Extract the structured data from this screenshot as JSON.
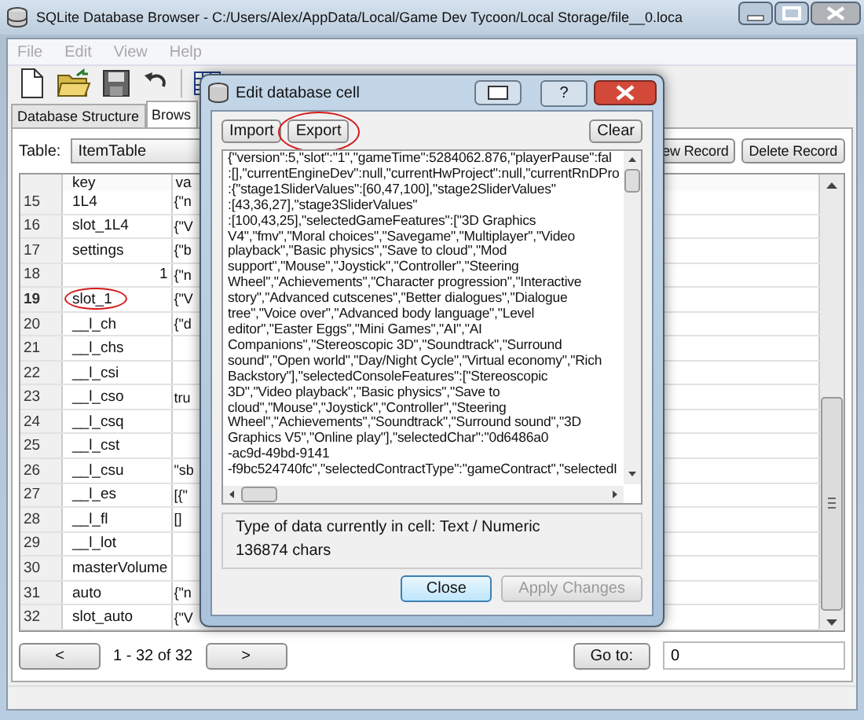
{
  "window": {
    "title": "SQLite Database Browser - C:/Users/Alex/AppData/Local/Game Dev Tycoon/Local Storage/file__0.loca"
  },
  "menu": [
    {
      "label": "File",
      "disabled": true
    },
    {
      "label": "Edit",
      "disabled": true
    },
    {
      "label": "View",
      "disabled": true
    },
    {
      "label": "Help",
      "disabled": true
    }
  ],
  "tabs": [
    {
      "label": "Database Structure",
      "selected": false
    },
    {
      "label": "Brows",
      "selected": true
    }
  ],
  "table_select": {
    "label": "Table:",
    "value": "ItemTable"
  },
  "record_buttons": [
    "ew Record",
    "Delete Record"
  ],
  "grid": {
    "columns": [
      "key",
      "va"
    ],
    "rows": [
      {
        "number": "15",
        "key": "1L4",
        "value": "{\"n",
        "current": false,
        "circled": false,
        "kind": "text"
      },
      {
        "number": "16",
        "key": "slot_1L4",
        "value": "{\"V",
        "current": false,
        "circled": false,
        "kind": "text"
      },
      {
        "number": "17",
        "key": "settings",
        "value": "{\"b",
        "current": false,
        "circled": false,
        "kind": "text"
      },
      {
        "number": "18",
        "key": "1",
        "value": "{\"n",
        "current": false,
        "circled": false,
        "kind": "number"
      },
      {
        "number": "19",
        "key": "slot_1",
        "value": "{\"V",
        "current": true,
        "circled": true,
        "kind": "text"
      },
      {
        "number": "20",
        "key": "__l_ch",
        "value": "{\"d",
        "current": false,
        "circled": false,
        "kind": "text"
      },
      {
        "number": "21",
        "key": "__l_chs",
        "current": false,
        "circled": false,
        "kind": "text"
      },
      {
        "number": "22",
        "key": "__l_csi",
        "current": false,
        "circled": false,
        "kind": "text"
      },
      {
        "number": "23",
        "key": "__l_cso",
        "value": "tru",
        "current": false,
        "circled": false,
        "kind": "text"
      },
      {
        "number": "24",
        "key": "__l_csq",
        "current": false,
        "circled": false,
        "kind": "text"
      },
      {
        "number": "25",
        "key": "__l_cst",
        "current": false,
        "circled": false,
        "kind": "text"
      },
      {
        "number": "26",
        "key": "__l_csu",
        "value": "\"sb",
        "current": false,
        "circled": false,
        "kind": "text"
      },
      {
        "number": "27",
        "key": "__l_es",
        "value": "[{\"",
        "current": false,
        "circled": false,
        "kind": "text"
      },
      {
        "number": "28",
        "key": "__l_fl",
        "value": "[]",
        "current": false,
        "circled": false,
        "kind": "text"
      },
      {
        "number": "29",
        "key": "__l_lot",
        "current": false,
        "circled": false,
        "kind": "text"
      },
      {
        "number": "30",
        "key": "masterVolume",
        "current": false,
        "circled": false,
        "kind": "text"
      },
      {
        "number": "31",
        "key": "auto",
        "value": "{\"n",
        "current": false,
        "circled": false,
        "kind": "text"
      },
      {
        "number": "32",
        "key": "slot_auto",
        "value": "{\"V",
        "current": false,
        "circled": false,
        "kind": "text"
      }
    ]
  },
  "pager": {
    "prev": "<",
    "range": "1 - 32 of 32",
    "next": ">",
    "goto_label": "Go to:",
    "goto_value": "0"
  },
  "dialog": {
    "title": "Edit database cell",
    "help": "?",
    "top_buttons": [
      {
        "label": "Import",
        "circled": false
      },
      {
        "label": "Export",
        "circled": true
      },
      {
        "label": "Clear",
        "circled": false
      }
    ],
    "content_lines": [
      "{\"version\":5,\"slot\":\"1\",\"gameTime\":5284062.876,\"playerPause\":fal",
      ":[],\"currentEngineDev\":null,\"currentHwProject\":null,\"currentRnDPro",
      ":{\"stage1SliderValues\":[60,47,100],\"stage2SliderValues\"",
      ":[43,36,27],\"stage3SliderValues\"",
      ":[100,43,25],\"selectedGameFeatures\":[\"3D Graphics",
      "V4\",\"fmv\",\"Moral choices\",\"Savegame\",\"Multiplayer\",\"Video",
      "playback\",\"Basic physics\",\"Save to cloud\",\"Mod",
      "support\",\"Mouse\",\"Joystick\",\"Controller\",\"Steering",
      "Wheel\",\"Achievements\",\"Character progression\",\"Interactive",
      "story\",\"Advanced cutscenes\",\"Better dialogues\",\"Dialogue",
      "tree\",\"Voice over\",\"Advanced body language\",\"Level",
      "editor\",\"Easter Eggs\",\"Mini Games\",\"AI\",\"AI",
      "Companions\",\"Stereoscopic 3D\",\"Soundtrack\",\"Surround",
      "sound\",\"Open world\",\"Day/Night Cycle\",\"Virtual economy\",\"Rich",
      "Backstory\"],\"selectedConsoleFeatures\":[\"Stereoscopic",
      "3D\",\"Video playback\",\"Basic physics\",\"Save to",
      "cloud\",\"Mouse\",\"Joystick\",\"Controller\",\"Steering",
      "Wheel\",\"Achievements\",\"Soundtrack\",\"Surround sound\",\"3D",
      "Graphics V5\",\"Online play\"],\"selectedChar\":\"0d6486a0",
      "-ac9d-49bd-9141",
      "-f9bc524740fc\",\"selectedContractType\":\"gameContract\",\"selectedI"
    ],
    "type_info": "Type of data currently in cell: Text / Numeric",
    "size": "136874 chars",
    "buttons": [
      {
        "label": "Close",
        "disabled": false
      },
      {
        "label": "Apply Changes",
        "disabled": true
      }
    ]
  }
}
